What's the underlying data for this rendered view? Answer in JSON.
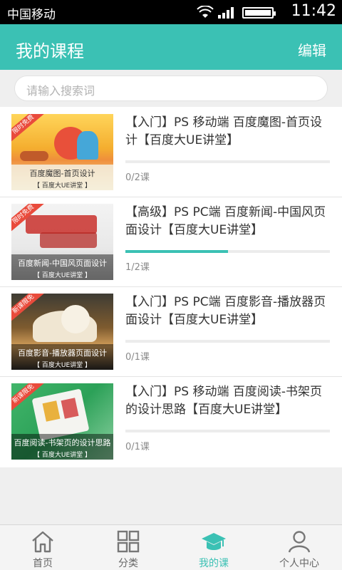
{
  "status_bar": {
    "carrier": "中国移动",
    "time": "11:42"
  },
  "header": {
    "title": "我的课程",
    "edit_label": "编辑"
  },
  "search": {
    "placeholder": "请输入搜索词"
  },
  "courses": [
    {
      "title": "【入门】PS 移动端 百度魔图-首页设计【百度大UE讲堂】",
      "progress": 0,
      "count": "0/2课",
      "thumb_caption": "百度魔图-首页设计",
      "thumb_subcaption": "【 百度大UE讲堂 】",
      "thumb_tag": "限时免费"
    },
    {
      "title": "【高级】PS PC端 百度新闻-中国风页面设计【百度大UE讲堂】",
      "progress": 0.5,
      "count": "1/2课",
      "thumb_caption": "百度新闻-中国风页面设计",
      "thumb_subcaption": "【 百度大UE讲堂 】",
      "thumb_tag": "限时免费"
    },
    {
      "title": "【入门】PS PC端 百度影音-播放器页面设计【百度大UE讲堂】",
      "progress": 0,
      "count": "0/1课",
      "thumb_caption": "百度影音-播放器页面设计",
      "thumb_subcaption": "【 百度大UE讲堂 】",
      "thumb_tag": "新课限免"
    },
    {
      "title": "【入门】PS 移动端 百度阅读-书架页的设计思路【百度大UE讲堂】",
      "progress": 0,
      "count": "0/1课",
      "thumb_caption": "百度阅读-书架页的设计思路",
      "thumb_subcaption": "【 百度大UE讲堂 】",
      "thumb_tag": "新课限免"
    }
  ],
  "tabbar": {
    "tabs": [
      {
        "label": "首页",
        "icon": "home-icon",
        "active": false
      },
      {
        "label": "分类",
        "icon": "grid-icon",
        "active": false
      },
      {
        "label": "我的课",
        "icon": "graduation-cap-icon",
        "active": true
      },
      {
        "label": "个人中心",
        "icon": "person-icon",
        "active": false
      }
    ]
  },
  "colors": {
    "accent": "#3bc1b4",
    "tag_red": "#e94b3c"
  }
}
